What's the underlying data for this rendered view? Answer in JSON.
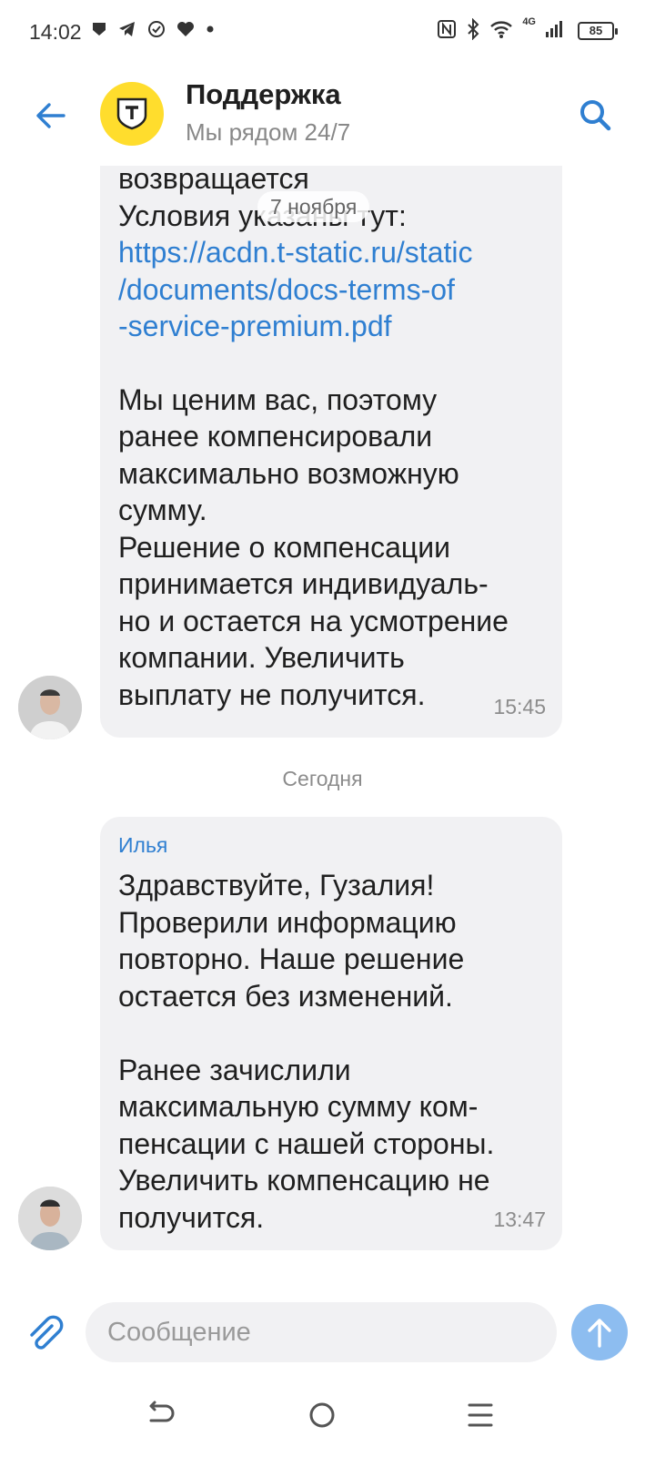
{
  "status_bar": {
    "time": "14:02",
    "network": "4G",
    "battery": "85"
  },
  "header": {
    "title": "Поддержка",
    "subtitle": "Мы рядом 24/7"
  },
  "chat": {
    "date_pill": "7 ноября",
    "message1": {
      "text_top": "возвращается\nУсловия указаны тут:",
      "link": "https://acdn.t-static.ru/static/documents/docs-terms-of-service-premium.pdf",
      "link_lines": "https://acdn.t-static.ru/static\n/documents/docs-terms-of\n-service-premium.pdf",
      "text_bottom": "Мы ценим вас, поэтому\nранее компенсировали\nмаксимально возможную\nсумму.\nРешение о компенсации\nпринимается индивидуаль-\nно и остается на усмотрение\nкомпании. Увеличить\nвыплату не получится.",
      "time": "15:45"
    },
    "day_label": "Сегодня",
    "message2": {
      "author": "Илья",
      "text": "Здравствуйте, Гузалия!\nПроверили информацию\nповторно. Наше решение\nостается без изменений.\n\nРанее зачислили\nмаксимальную сумму ком-\nпенсации с нашей стороны.\nУвеличить компенсацию не\nполучится.",
      "time": "13:47"
    }
  },
  "input": {
    "placeholder": "Сообщение"
  },
  "colors": {
    "accent": "#2f7fd1",
    "brand_yellow": "#ffdd2d",
    "bubble": "#f1f1f3",
    "send_button": "#8dbdf0"
  }
}
